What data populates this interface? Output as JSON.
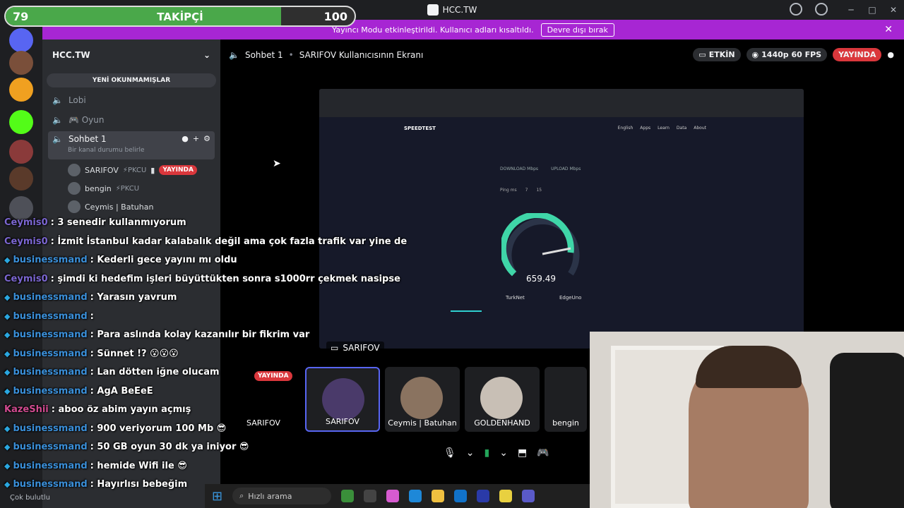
{
  "window": {
    "title": "HCC.TW"
  },
  "banner": {
    "text": "Yayıncı Modu etkinleştirildi. Kullanıcı adları kısaltıldı.",
    "button": "Devre dışı bırak",
    "close": "✕"
  },
  "follow_bar": {
    "current": "79",
    "label": "TAKİPÇİ",
    "goal": "100",
    "progress": 0.79
  },
  "sidebar": {
    "guild_name": "HCC.TW",
    "unread_label": "YENİ OKUNMAMIŞLAR",
    "channels": [
      {
        "name": "Lobi"
      },
      {
        "name": "🎮 Oyun"
      },
      {
        "name": "Sohbet 1",
        "status": "Bir kanal durumu belirle"
      }
    ],
    "members": [
      {
        "name": "SARIFOV",
        "tag": "⚡PKCU",
        "live": "YAYINDA"
      },
      {
        "name": "bengin",
        "tag": "⚡PKCU"
      },
      {
        "name": "Ceymis | Batuhan"
      }
    ],
    "user_status": "Çok bulutlu"
  },
  "header": {
    "channel": "Sohbet 1",
    "screen_title": "SARIFOV Kullanıcısının Ekranı",
    "active": "ETKİN",
    "quality": "1440p 60 FPS",
    "live": "YAYINDA"
  },
  "stream": {
    "label": "SARIFOV",
    "logo": "SPEEDTEST",
    "nav": [
      "English",
      "Apps",
      "Learn",
      "Data",
      "About"
    ],
    "tabs": [
      "DOWNLOAD Mbps",
      "UPLOAD Mbps"
    ],
    "pings": [
      "Ping ms",
      "7",
      "15"
    ],
    "speed": "659.49",
    "isp": "TurkNet",
    "server": "EdgeUno"
  },
  "tiles": [
    {
      "name": "SARIFOV",
      "live": "YAYINDA"
    },
    {
      "name": "SARIFOV"
    },
    {
      "name": "Ceymis | Batuhan"
    },
    {
      "name": "GOLDENHAND"
    },
    {
      "name": "bengin"
    }
  ],
  "chat": [
    {
      "user": "Ceymis0",
      "text": ": 3 senedir kullanmıyorum",
      "kind": "cey"
    },
    {
      "user": "Ceymis0",
      "text": ": İzmit İstanbul kadar kalabalık değil ama çok fazla trafik var yine de",
      "kind": "cey"
    },
    {
      "user": "businessmand",
      "text": ": Kederli gece yayını mı oldu",
      "kind": "bm"
    },
    {
      "user": "Ceymis0",
      "text": ": şimdi ki hedefim işleri büyüttükten sonra s1000rr çekmek nasipse",
      "kind": "cey"
    },
    {
      "user": "businessmand",
      "text": ": Yarasın yavrum",
      "kind": "bm"
    },
    {
      "user": "businessmand",
      "text": ":",
      "kind": "bm"
    },
    {
      "user": "businessmand",
      "text": ": Para aslında kolay kazanılır bir fikrim var",
      "kind": "bm"
    },
    {
      "user": "businessmand",
      "text": ": Sünnet !? 😮😮😮",
      "kind": "bm"
    },
    {
      "user": "businessmand",
      "text": ": Lan dötten iğne olucam",
      "kind": "bm"
    },
    {
      "user": "businessmand",
      "text": ": AgA BeEeE",
      "kind": "bm"
    },
    {
      "user": "KazeShii",
      "text": ": aboo öz abim yayın açmış",
      "kind": "kaz"
    },
    {
      "user": "businessmand",
      "text": ": 900 veriyorum 100 Mb 😎",
      "kind": "bm"
    },
    {
      "user": "businessmand",
      "text": ": 50 GB oyun 30 dk ya iniyor 😎",
      "kind": "bm"
    },
    {
      "user": "businessmand",
      "text": ": hemide Wifi ile 😎",
      "kind": "bm"
    },
    {
      "user": "businessmand",
      "text": ": Hayırlısı bebeğim",
      "kind": "bm"
    }
  ],
  "taskbar": {
    "search_placeholder": "Hızlı arama"
  },
  "colors": {
    "live": "#da373c",
    "banner": "#a726d3",
    "follow_fill": "#4aa84a",
    "blurple": "#5865f2"
  }
}
